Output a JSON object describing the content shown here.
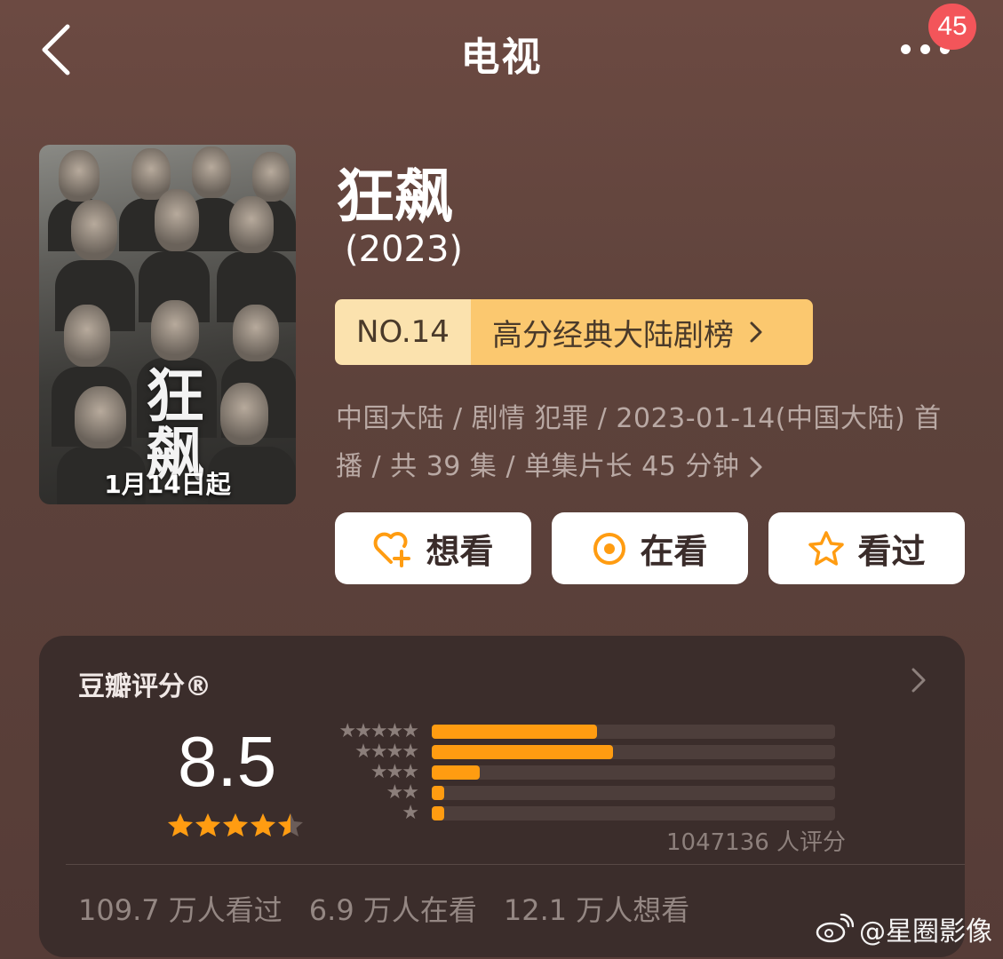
{
  "header": {
    "title": "电视",
    "more_badge": "45"
  },
  "poster": {
    "title_chars": "狂飙",
    "date_text": "1月14日起"
  },
  "show": {
    "name": "狂飙",
    "year": "(2023)",
    "rank": {
      "number": "NO.14",
      "label": "高分经典大陆剧榜"
    },
    "meta_line1": "中国大陆 / 剧情 犯罪 / 2023-01-14(中国大陆) 首",
    "meta_line2": "播 / 共 39 集 / 单集片长 45 分钟"
  },
  "actions": {
    "want": "想看",
    "watching": "在看",
    "watched": "看过"
  },
  "rating": {
    "title": "豆瓣评分®",
    "score": "8.5",
    "stars": 4.5,
    "distribution": [
      {
        "stars": "★★★★★",
        "fraction": 0.41
      },
      {
        "stars": "★★★★",
        "fraction": 0.45
      },
      {
        "stars": "★★★",
        "fraction": 0.12
      },
      {
        "stars": "★★",
        "fraction": 0.03
      },
      {
        "stars": "★",
        "fraction": 0.03
      }
    ],
    "vote_count": "1047136 人评分",
    "stats": {
      "watched": "109.7 万人看过",
      "watching": "6.9 万人在看",
      "want": "12.1 万人想看"
    }
  },
  "watermark": "@星圈影像",
  "colors": {
    "accent": "#ff9c11",
    "badge": "#f3555a",
    "rank_left": "#fbe2ae",
    "rank_right": "#fbc86f",
    "card_bg": "#3b2d2b"
  }
}
